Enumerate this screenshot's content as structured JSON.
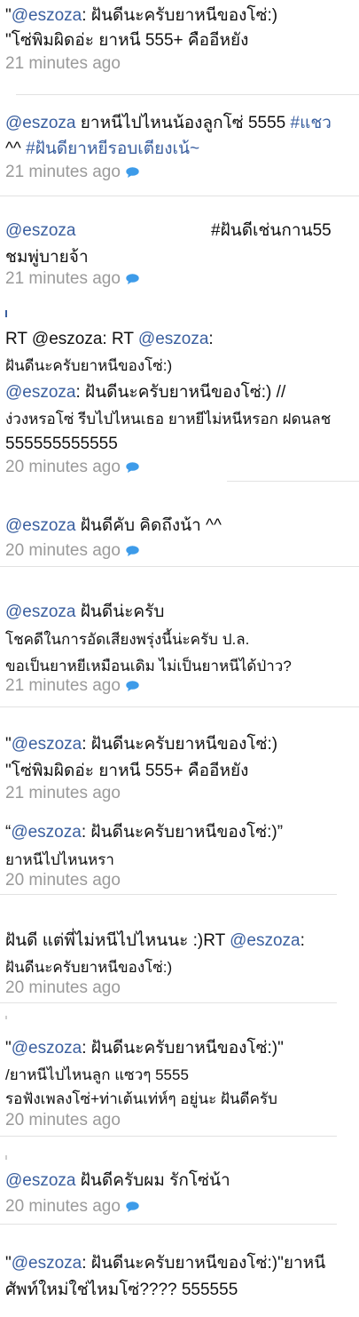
{
  "tweets": [
    {
      "line1_pre": "\"",
      "line1_mention": "@eszoza",
      "line1_text": ": ฝันดีนะครับยาหนีของโซ่:)",
      "line2": "\"โซ่พิมผิดอ่ะ ยาหนี 555+ คืออีหยัง",
      "time": "21 minutes ago"
    },
    {
      "mention": "@eszoza",
      "text": " ยาหนีไปไหนน้องลูกโซ่ 5555 ",
      "hashtag1": "#แชว",
      "line2_pre": "^^ ",
      "hashtag2": "#ฝันดียาหยีรอบเตียงเน้~",
      "time": "21 minutes ago"
    },
    {
      "mention": "@eszoza",
      "hashtag": "#ฝันดีเช่นกาน55",
      "line2": "ชมพู่บายจ้า",
      "time": "21 minutes ago"
    },
    {
      "line1_pre": "RT ",
      "line1_mention": "@eszoza",
      "line1_mid": ": RT ",
      "line1_mention2": "@eszoza",
      "line1_post": ":",
      "line2": "ฝันดีนะครับยาหนีของโซ่:)",
      "line3_mention": "@eszoza",
      "line3_text": ": ฝันดีนะครับยาหนีของโซ่:) //",
      "line4": "ง่วงหรอโซ่ รีบไปไหนเธอ ยาหยีไม่หนีหรอก ฝดนลช",
      "line5": "555555555555",
      "time": "20 minutes ago"
    },
    {
      "mention": "@eszoza",
      "text": " ฝันดีคับ คิดถึงน้า ^^",
      "time": "20 minutes ago"
    },
    {
      "mention": "@eszoza",
      "text": " ฝันดีน่ะครับ",
      "line2": "โชคดีในการอัดเสียงพรุ่งนี้น่ะครับ ป.ล.",
      "line3": "ขอเป็นยาหยีเหมือนเดิม ไม่เป็นยาหนีได้ป่าว?",
      "time": "21 minutes ago"
    },
    {
      "line1_pre": "\"",
      "line1_mention": "@eszoza",
      "line1_text": ": ฝันดีนะครับยาหนีของโซ่:)",
      "line2": "\"โซ่พิมผิดอ่ะ ยาหนี 555+ คืออีหยัง",
      "time": "21 minutes ago"
    },
    {
      "line1_pre": "“",
      "line1_mention": "@eszoza",
      "line1_text": ": ฝันดีนะครับยาหนีของโซ่:)”",
      "line2": "ยาหนีไปไหนหรา",
      "time": "20 minutes ago"
    },
    {
      "line1_text": "ฝันดี แต่พี่ไม่หนีไปไหนนะ :)RT ",
      "line1_mention": "@eszoza",
      "line1_post": ":",
      "line2": "ฝันดีนะครับยาหนีของโซ่:)",
      "time": "20 minutes ago"
    },
    {
      "line1_pre": "\"",
      "line1_mention": "@eszoza",
      "line1_text": ": ฝันดีนะครับยาหนีของโซ่:)\"",
      "line2": "/ยาหนีไปไหนลูก แซวๆ 5555",
      "line3": "รอฟังเพลงโซ่+ท่าเต้นเท่ห์ๆ อยู่นะ ฝันดีครับ",
      "time": "20 minutes ago"
    },
    {
      "mention": "@eszoza",
      "text": " ฝันดีครับผม รักโซ่น้า",
      "time": "20 minutes ago"
    },
    {
      "line1_pre": "\"",
      "line1_mention": "@eszoza",
      "line1_text": ": ฝันดีนะครับยาหนีของโซ่:)\"ยาหนี",
      "line2": "ศัพท์ใหม่ใช่ไหมโซ่???? 555555"
    }
  ],
  "colors": {
    "link": "#3a5f9f",
    "time": "#9a9a9a",
    "bubble": "#3d9be9",
    "separator": "#e2e2e2"
  },
  "icons": {
    "reply": "speech-bubble-icon"
  }
}
